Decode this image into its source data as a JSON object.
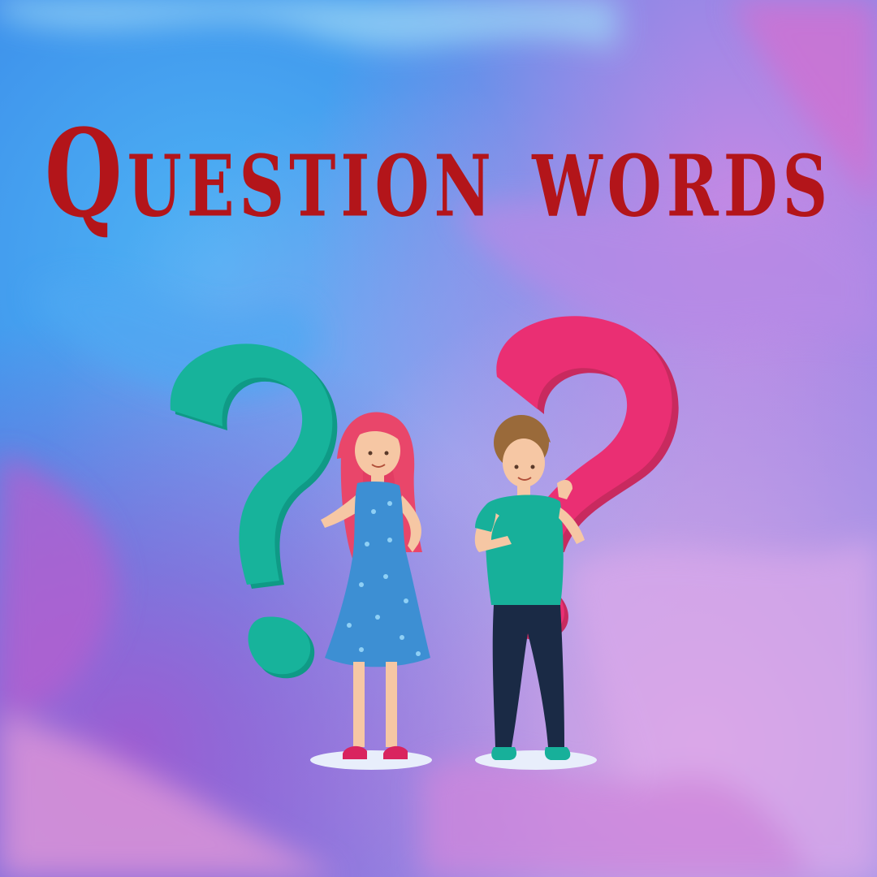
{
  "title": "Question words",
  "colors": {
    "title": "#b3151a",
    "bg_blue": "#3aa2f0",
    "bg_purple": "#a46ad8",
    "bg_pink": "#e77fd3",
    "question_mark_teal": "#15b39b",
    "question_mark_pink": "#ea2f73",
    "girl_dress": "#3d8fd3",
    "boy_shirt": "#17b09a",
    "boy_pants": "#1a2a45",
    "hair_girl": "#e9466a",
    "hair_boy": "#9a6a3a"
  },
  "illustration": {
    "icons": [
      "teal-question-mark-icon",
      "pink-question-mark-icon",
      "girl-figure",
      "boy-figure"
    ]
  }
}
